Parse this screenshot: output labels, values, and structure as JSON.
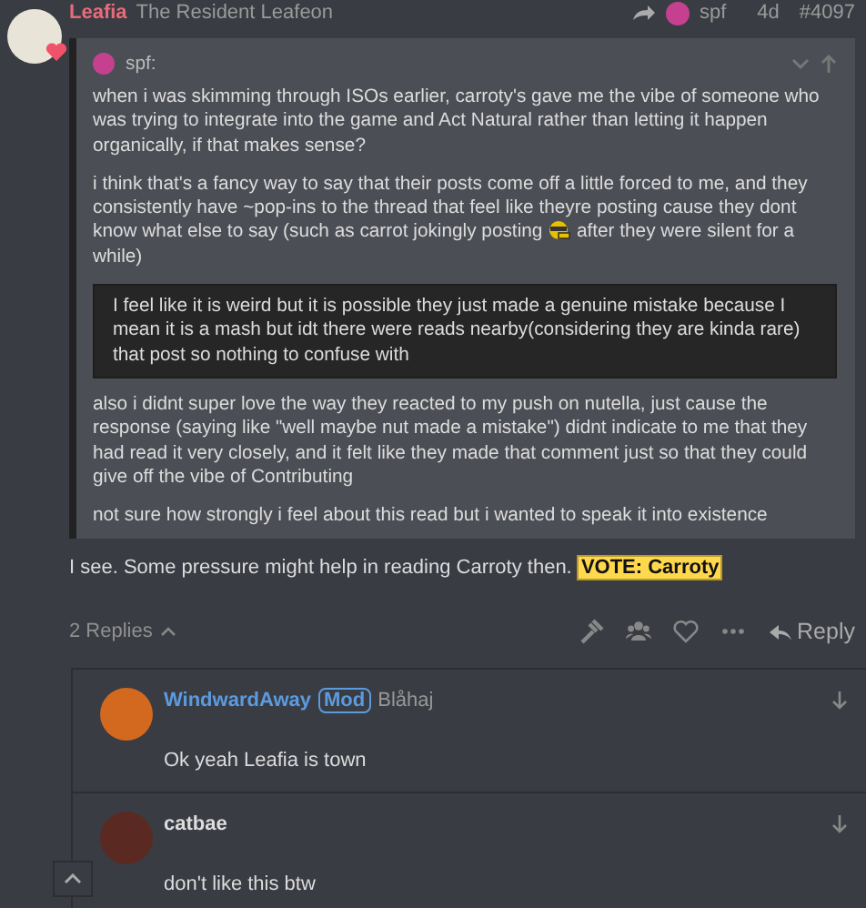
{
  "post": {
    "author": "Leafia",
    "title": "The Resident Leafeon",
    "reply_to": "spf",
    "age": "4d",
    "number": "#4097",
    "quote": {
      "author": "spf:",
      "expanded": false,
      "paragraphs": [
        {
          "kind": "text",
          "text": "when i was skimming through ISOs earlier, carroty's gave me the vibe of someone who was trying to integrate into the game and Act Natural rather than letting it happen organically, if that makes sense?"
        },
        {
          "kind": "emoji",
          "before": "i think that's a fancy way to say that their posts come off a little forced to me, and they consistently have ~pop-ins to the thread that feel like theyre posting cause they dont know what else to say (such as carrot jokingly posting",
          "after": "after they were silent for a while)"
        },
        {
          "kind": "blockquote",
          "text": "I feel like it is weird but it is possible they just made a genuine mistake because I mean it is a mash but idt there were reads nearby(considering they are kinda rare) that post so nothing to confuse with"
        },
        {
          "kind": "text",
          "text": "also i didnt super love the way they reacted to my push on nutella, just cause the response (saying like \"well maybe nut made a mistake\") didnt indicate to me that they had read it very closely, and it felt like they made that comment just so that they could give off the vibe of Contributing"
        },
        {
          "kind": "text",
          "text": "not sure how strongly i feel about this read but i wanted to speak it into existence"
        }
      ]
    },
    "text": "I see. Some pressure might help in reading Carroty then.",
    "vote": "VOTE: Carroty",
    "replies_label": "2 Replies",
    "replies_expanded": true,
    "liked": false,
    "reply_button": "Reply"
  },
  "replies": [
    {
      "author": "WindwardAway",
      "badge": "Mod",
      "title": "Blåhaj",
      "text": "Ok yeah Leafia is town"
    },
    {
      "author": "catbae",
      "text": "don't like this btw"
    }
  ]
}
